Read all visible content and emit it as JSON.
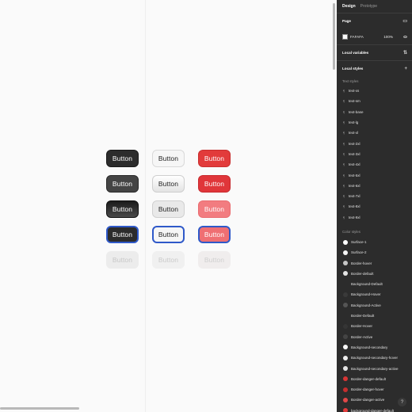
{
  "canvas": {
    "button_label": "Button",
    "rows": [
      [
        "n",
        "n",
        "n"
      ],
      [
        "h",
        "h",
        "h"
      ],
      [
        "a",
        "a",
        "a"
      ],
      [
        "f",
        "f",
        "f"
      ],
      [
        "d",
        "d",
        "d"
      ]
    ]
  },
  "panel": {
    "tabs": {
      "design": "Design",
      "prototype": "Prototype"
    },
    "page": {
      "title": "Page",
      "color_hex": "FAFAFA",
      "opacity": "100%"
    },
    "local_variables": "Local variables",
    "local_styles": "Local styles",
    "text_styles_heading": "Text styles",
    "text_styles": [
      "text-xs",
      "text-sm",
      "text-base",
      "text-lg",
      "text-xl",
      "text-2xl",
      "text-3xl",
      "text-4xl",
      "text-5xl",
      "text-6xl",
      "text-7xl",
      "text-8xl",
      "text-9xl"
    ],
    "color_styles_heading": "Color styles",
    "color_styles": [
      {
        "name": "Surface-1",
        "color": "#ffffff"
      },
      {
        "name": "Surface-2",
        "color": "#f5f5f5"
      },
      {
        "name": "Border-hover",
        "color": "#c6c6c6"
      },
      {
        "name": "Border-default",
        "color": "#e4e4e4"
      },
      {
        "name": "Background-Default",
        "color": "#2c2c2c"
      },
      {
        "name": "Background-Hover",
        "color": "#3a3a3a"
      },
      {
        "name": "Background-Active",
        "color": "#555555"
      },
      {
        "name": "Border-Default",
        "color": "#2c2c2c"
      },
      {
        "name": "Border-Hover",
        "color": "#353535"
      },
      {
        "name": "Border-Active",
        "color": "#444444"
      },
      {
        "name": "Background-secondary",
        "color": "#fafafa"
      },
      {
        "name": "Background-secondary-hover",
        "color": "#eeeeee"
      },
      {
        "name": "Background-secondary-active",
        "color": "#e5e5e5"
      },
      {
        "name": "Border-danger-default",
        "color": "#d93636"
      },
      {
        "name": "Border-danger-hover",
        "color": "#c42e2e"
      },
      {
        "name": "Border-danger-active",
        "color": "#e04848"
      },
      {
        "name": "background-danger-default",
        "color": "#e23b3b"
      }
    ],
    "help_icon": "?"
  }
}
